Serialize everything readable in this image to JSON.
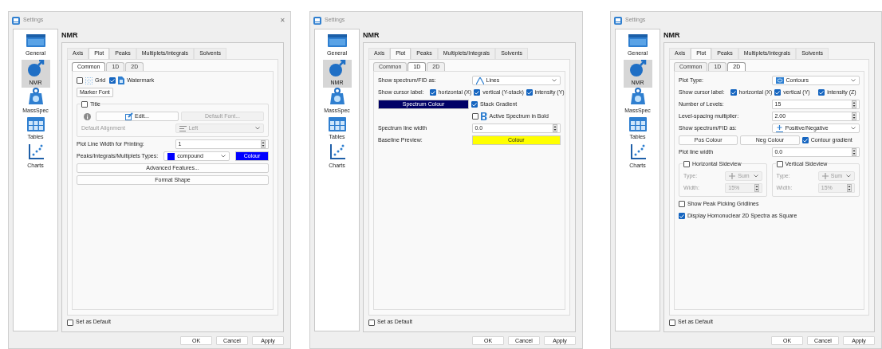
{
  "windows": [
    {
      "title": "Settings",
      "close": "✕",
      "sidebar": [
        {
          "label": "General",
          "selected": false
        },
        {
          "label": "NMR",
          "selected": true
        },
        {
          "label": "MassSpec",
          "selected": false
        },
        {
          "label": "Tables",
          "selected": false
        },
        {
          "label": "Charts",
          "selected": false
        }
      ],
      "heading": "NMR",
      "tabs": [
        {
          "label": "Axis",
          "selected": false
        },
        {
          "label": "Plot",
          "selected": true
        },
        {
          "label": "Peaks",
          "selected": false
        },
        {
          "label": "Multiplets/Integrals",
          "selected": false
        },
        {
          "label": "Solvents",
          "selected": false
        }
      ],
      "subtabs": [
        {
          "label": "Common",
          "selected": true
        },
        {
          "label": "1D",
          "selected": false
        },
        {
          "label": "2D",
          "selected": false
        }
      ],
      "rows": [
        {
          "kind": "row",
          "cells": [
            {
              "kind": "gridcheckbox",
              "label": "Grid",
              "checked": false
            },
            {
              "kind": "watermarkcheckbox",
              "label": "Watermark",
              "checked": true
            }
          ]
        },
        {
          "kind": "small_button",
          "label": "Marker Font"
        },
        {
          "kind": "group",
          "title": "Title",
          "checked": false,
          "rows": [
            {
              "kind": "row",
              "cells": [
                {
                  "kind": "info",
                  "disabled": true
                },
                {
                  "kind": "editbutton",
                  "label": "Edit...",
                  "disabled": false
                },
                {
                  "kind": "button",
                  "label": "Default Font...",
                  "disabled": true
                }
              ]
            },
            {
              "kind": "row",
              "cells": [
                {
                  "kind": "text",
                  "label": "Default Alignment",
                  "disabled": true
                },
                {
                  "kind": "aligndropdown",
                  "value": "Left",
                  "disabled": true
                }
              ]
            }
          ]
        },
        {
          "kind": "row",
          "cells": [
            {
              "kind": "text",
              "label": "Plot Line Width for Printing:"
            },
            {
              "kind": "spin",
              "value": "1"
            }
          ]
        },
        {
          "kind": "row",
          "cells": [
            {
              "kind": "text",
              "label": "Peaks/Integrals/Multiplets Types:"
            },
            {
              "kind": "dropdown",
              "value": "compound",
              "color": "#0000ff"
            },
            {
              "kind": "colour_button",
              "label": "Colour",
              "color": "#0000ff"
            }
          ]
        },
        {
          "kind": "wide_button",
          "label": "Advanced Features..."
        },
        {
          "kind": "wide_button",
          "label": "Format Shape"
        }
      ],
      "set_as_default": {
        "label": "Set as Default",
        "checked": false
      },
      "buttons": [
        "OK",
        "Cancel",
        "Apply"
      ]
    },
    {
      "title": "Settings",
      "sidebar": [
        {
          "label": "General",
          "selected": false
        },
        {
          "label": "NMR",
          "selected": true
        },
        {
          "label": "MassSpec",
          "selected": false
        },
        {
          "label": "Tables",
          "selected": false
        },
        {
          "label": "Charts",
          "selected": false
        }
      ],
      "heading": "NMR",
      "tabs": [
        {
          "label": "Axis",
          "selected": false
        },
        {
          "label": "Plot",
          "selected": true
        },
        {
          "label": "Peaks",
          "selected": false
        },
        {
          "label": "Multiplets/Integrals",
          "selected": false
        },
        {
          "label": "Solvents",
          "selected": false
        }
      ],
      "subtabs": [
        {
          "label": "Common",
          "selected": false
        },
        {
          "label": "1D",
          "selected": true
        },
        {
          "label": "2D",
          "selected": false
        }
      ],
      "rows": [
        {
          "kind": "row",
          "cells": [
            {
              "kind": "text",
              "label": "Show spectrum/FID as:"
            },
            {
              "kind": "linesdropdown",
              "value": "Lines"
            }
          ]
        },
        {
          "kind": "row",
          "cells": [
            {
              "kind": "text",
              "label": "Show cursor label:"
            },
            {
              "kind": "checkbox",
              "label": "horizontal (X)",
              "checked": true
            },
            {
              "kind": "checkbox",
              "label": "vertical (Y-stack)",
              "checked": true
            },
            {
              "kind": "checkbox",
              "label": "intensity (Y)",
              "checked": true
            }
          ]
        },
        {
          "kind": "row",
          "cells": [
            {
              "kind": "colour_button",
              "label": "Spectrum Colour",
              "color": "#000066"
            },
            {
              "kind": "checkbox",
              "label": "Stack Gradient",
              "checked": true
            }
          ]
        },
        {
          "kind": "row",
          "cells": [
            {
              "kind": "gap"
            },
            {
              "kind": "boldcheckbox",
              "label": "Active Spectrum in Bold",
              "checked": false
            }
          ]
        },
        {
          "kind": "row",
          "cells": [
            {
              "kind": "text",
              "label": "Spectrum line width"
            },
            {
              "kind": "spin",
              "value": "0.0"
            }
          ]
        },
        {
          "kind": "row",
          "cells": [
            {
              "kind": "text",
              "label": "Baseline Preview:"
            },
            {
              "kind": "colour_button",
              "label": "Colour",
              "color": "#ffff00"
            }
          ]
        }
      ],
      "set_as_default": {
        "label": "Set as Default",
        "checked": false
      },
      "buttons": [
        "OK",
        "Cancel",
        "Apply"
      ]
    },
    {
      "title": "Settings",
      "sidebar": [
        {
          "label": "General",
          "selected": false
        },
        {
          "label": "NMR",
          "selected": true
        },
        {
          "label": "MassSpec",
          "selected": false
        },
        {
          "label": "Tables",
          "selected": false
        },
        {
          "label": "Charts",
          "selected": false
        }
      ],
      "heading": "NMR",
      "tabs": [
        {
          "label": "Axis",
          "selected": false
        },
        {
          "label": "Plot",
          "selected": true
        },
        {
          "label": "Peaks",
          "selected": false
        },
        {
          "label": "Multiplets/Integrals",
          "selected": false
        },
        {
          "label": "Solvents",
          "selected": false
        }
      ],
      "subtabs": [
        {
          "label": "Common",
          "selected": false
        },
        {
          "label": "1D",
          "selected": false
        },
        {
          "label": "2D",
          "selected": true
        }
      ],
      "rows": [
        {
          "kind": "row",
          "cells": [
            {
              "kind": "text",
              "label": "Plot Type:"
            },
            {
              "kind": "contourdropdown",
              "value": "Contours"
            }
          ]
        },
        {
          "kind": "row",
          "cells": [
            {
              "kind": "text",
              "label": "Show cursor label:"
            },
            {
              "kind": "checkbox",
              "label": "horizontal (X)",
              "checked": true
            },
            {
              "kind": "checkbox",
              "label": "vertical (Y)",
              "checked": true
            },
            {
              "kind": "checkbox",
              "label": "intensity (Z)",
              "checked": true
            }
          ]
        },
        {
          "kind": "row",
          "cells": [
            {
              "kind": "text",
              "label": "Number of Levels:"
            },
            {
              "kind": "spin",
              "value": "15"
            }
          ]
        },
        {
          "kind": "row",
          "cells": [
            {
              "kind": "text",
              "label": "Level-spacing multiplier:"
            },
            {
              "kind": "spin",
              "value": "2.00"
            }
          ]
        },
        {
          "kind": "row",
          "cells": [
            {
              "kind": "text",
              "label": "Show spectrum/FID as:"
            },
            {
              "kind": "posnegdropdown",
              "value": "Positive/Negative"
            }
          ]
        },
        {
          "kind": "row",
          "cells": [
            {
              "kind": "button",
              "label": "Pos Colour",
              "disabled": false
            },
            {
              "kind": "button",
              "label": "Neg Colour",
              "disabled": false
            },
            {
              "kind": "checkbox",
              "label": "Contour gradient",
              "checked": true
            }
          ]
        },
        {
          "kind": "row",
          "cells": [
            {
              "kind": "text",
              "label": "Plot line width"
            },
            {
              "kind": "spin",
              "value": "0.0"
            }
          ]
        },
        {
          "kind": "groups",
          "groups": [
            {
              "title": "Horizontal Sideview",
              "checked": false,
              "rows": [
                {
                  "kind": "row",
                  "cells": [
                    {
                      "kind": "text",
                      "label": "Type:",
                      "disabled": true
                    },
                    {
                      "kind": "sumdropdown",
                      "value": "Sum",
                      "disabled": true
                    }
                  ]
                },
                {
                  "kind": "row",
                  "cells": [
                    {
                      "kind": "text",
                      "label": "Width:",
                      "disabled": true
                    },
                    {
                      "kind": "spin",
                      "value": "15%",
                      "disabled": true
                    }
                  ]
                }
              ]
            },
            {
              "title": "Vertical Sideview",
              "checked": false,
              "rows": [
                {
                  "kind": "row",
                  "cells": [
                    {
                      "kind": "text",
                      "label": "Type:",
                      "disabled": true
                    },
                    {
                      "kind": "sumdropdown",
                      "value": "Sum",
                      "disabled": true
                    }
                  ]
                },
                {
                  "kind": "row",
                  "cells": [
                    {
                      "kind": "text",
                      "label": "Width:",
                      "disabled": true
                    },
                    {
                      "kind": "spin",
                      "value": "15%",
                      "disabled": true
                    }
                  ]
                }
              ]
            }
          ]
        },
        {
          "kind": "row",
          "cells": [
            {
              "kind": "checkbox",
              "label": "Show Peak Picking Gridlines",
              "checked": false
            }
          ]
        },
        {
          "kind": "row",
          "cells": [
            {
              "kind": "checkbox",
              "label": "Display Homonuclear 2D Spectra as Square",
              "checked": true
            }
          ]
        }
      ],
      "set_as_default": {
        "label": "Set as Default",
        "checked": false
      },
      "buttons": [
        "OK",
        "Cancel",
        "Apply"
      ]
    }
  ]
}
